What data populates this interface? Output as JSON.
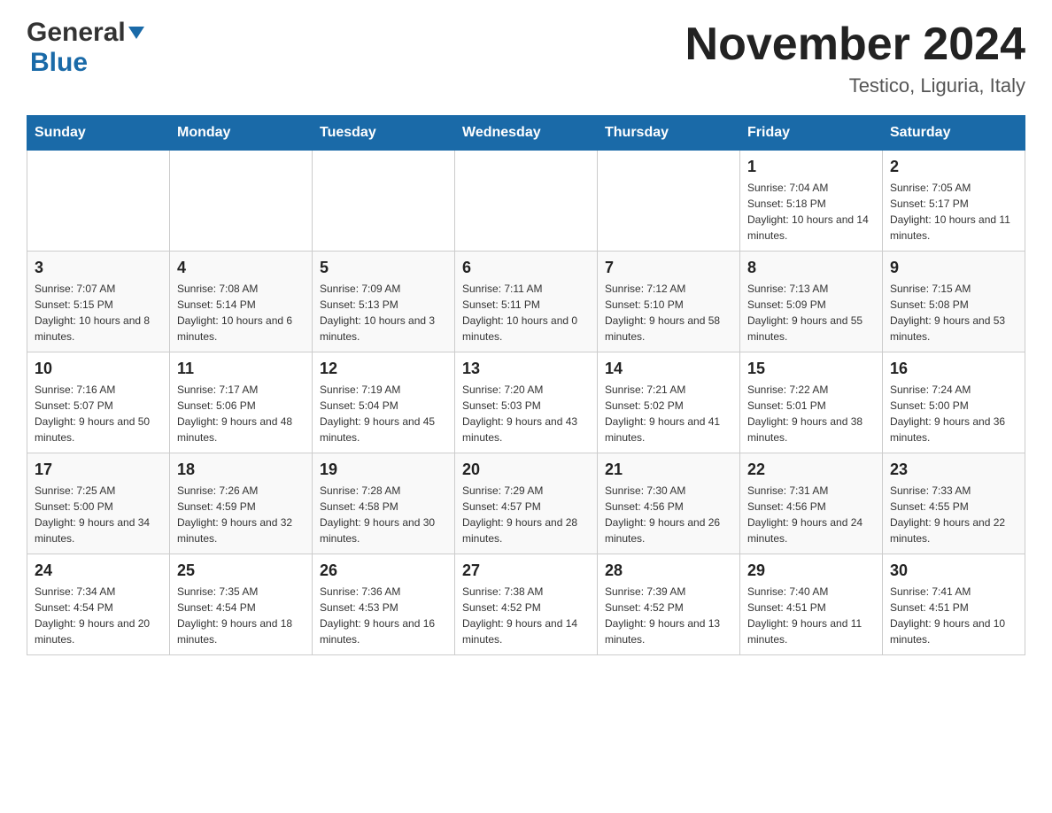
{
  "header": {
    "logo_general": "General",
    "logo_blue": "Blue",
    "month_year": "November 2024",
    "location": "Testico, Liguria, Italy"
  },
  "weekdays": [
    "Sunday",
    "Monday",
    "Tuesday",
    "Wednesday",
    "Thursday",
    "Friday",
    "Saturday"
  ],
  "weeks": [
    [
      {
        "day": "",
        "sunrise": "",
        "sunset": "",
        "daylight": ""
      },
      {
        "day": "",
        "sunrise": "",
        "sunset": "",
        "daylight": ""
      },
      {
        "day": "",
        "sunrise": "",
        "sunset": "",
        "daylight": ""
      },
      {
        "day": "",
        "sunrise": "",
        "sunset": "",
        "daylight": ""
      },
      {
        "day": "",
        "sunrise": "",
        "sunset": "",
        "daylight": ""
      },
      {
        "day": "1",
        "sunrise": "Sunrise: 7:04 AM",
        "sunset": "Sunset: 5:18 PM",
        "daylight": "Daylight: 10 hours and 14 minutes."
      },
      {
        "day": "2",
        "sunrise": "Sunrise: 7:05 AM",
        "sunset": "Sunset: 5:17 PM",
        "daylight": "Daylight: 10 hours and 11 minutes."
      }
    ],
    [
      {
        "day": "3",
        "sunrise": "Sunrise: 7:07 AM",
        "sunset": "Sunset: 5:15 PM",
        "daylight": "Daylight: 10 hours and 8 minutes."
      },
      {
        "day": "4",
        "sunrise": "Sunrise: 7:08 AM",
        "sunset": "Sunset: 5:14 PM",
        "daylight": "Daylight: 10 hours and 6 minutes."
      },
      {
        "day": "5",
        "sunrise": "Sunrise: 7:09 AM",
        "sunset": "Sunset: 5:13 PM",
        "daylight": "Daylight: 10 hours and 3 minutes."
      },
      {
        "day": "6",
        "sunrise": "Sunrise: 7:11 AM",
        "sunset": "Sunset: 5:11 PM",
        "daylight": "Daylight: 10 hours and 0 minutes."
      },
      {
        "day": "7",
        "sunrise": "Sunrise: 7:12 AM",
        "sunset": "Sunset: 5:10 PM",
        "daylight": "Daylight: 9 hours and 58 minutes."
      },
      {
        "day": "8",
        "sunrise": "Sunrise: 7:13 AM",
        "sunset": "Sunset: 5:09 PM",
        "daylight": "Daylight: 9 hours and 55 minutes."
      },
      {
        "day": "9",
        "sunrise": "Sunrise: 7:15 AM",
        "sunset": "Sunset: 5:08 PM",
        "daylight": "Daylight: 9 hours and 53 minutes."
      }
    ],
    [
      {
        "day": "10",
        "sunrise": "Sunrise: 7:16 AM",
        "sunset": "Sunset: 5:07 PM",
        "daylight": "Daylight: 9 hours and 50 minutes."
      },
      {
        "day": "11",
        "sunrise": "Sunrise: 7:17 AM",
        "sunset": "Sunset: 5:06 PM",
        "daylight": "Daylight: 9 hours and 48 minutes."
      },
      {
        "day": "12",
        "sunrise": "Sunrise: 7:19 AM",
        "sunset": "Sunset: 5:04 PM",
        "daylight": "Daylight: 9 hours and 45 minutes."
      },
      {
        "day": "13",
        "sunrise": "Sunrise: 7:20 AM",
        "sunset": "Sunset: 5:03 PM",
        "daylight": "Daylight: 9 hours and 43 minutes."
      },
      {
        "day": "14",
        "sunrise": "Sunrise: 7:21 AM",
        "sunset": "Sunset: 5:02 PM",
        "daylight": "Daylight: 9 hours and 41 minutes."
      },
      {
        "day": "15",
        "sunrise": "Sunrise: 7:22 AM",
        "sunset": "Sunset: 5:01 PM",
        "daylight": "Daylight: 9 hours and 38 minutes."
      },
      {
        "day": "16",
        "sunrise": "Sunrise: 7:24 AM",
        "sunset": "Sunset: 5:00 PM",
        "daylight": "Daylight: 9 hours and 36 minutes."
      }
    ],
    [
      {
        "day": "17",
        "sunrise": "Sunrise: 7:25 AM",
        "sunset": "Sunset: 5:00 PM",
        "daylight": "Daylight: 9 hours and 34 minutes."
      },
      {
        "day": "18",
        "sunrise": "Sunrise: 7:26 AM",
        "sunset": "Sunset: 4:59 PM",
        "daylight": "Daylight: 9 hours and 32 minutes."
      },
      {
        "day": "19",
        "sunrise": "Sunrise: 7:28 AM",
        "sunset": "Sunset: 4:58 PM",
        "daylight": "Daylight: 9 hours and 30 minutes."
      },
      {
        "day": "20",
        "sunrise": "Sunrise: 7:29 AM",
        "sunset": "Sunset: 4:57 PM",
        "daylight": "Daylight: 9 hours and 28 minutes."
      },
      {
        "day": "21",
        "sunrise": "Sunrise: 7:30 AM",
        "sunset": "Sunset: 4:56 PM",
        "daylight": "Daylight: 9 hours and 26 minutes."
      },
      {
        "day": "22",
        "sunrise": "Sunrise: 7:31 AM",
        "sunset": "Sunset: 4:56 PM",
        "daylight": "Daylight: 9 hours and 24 minutes."
      },
      {
        "day": "23",
        "sunrise": "Sunrise: 7:33 AM",
        "sunset": "Sunset: 4:55 PM",
        "daylight": "Daylight: 9 hours and 22 minutes."
      }
    ],
    [
      {
        "day": "24",
        "sunrise": "Sunrise: 7:34 AM",
        "sunset": "Sunset: 4:54 PM",
        "daylight": "Daylight: 9 hours and 20 minutes."
      },
      {
        "day": "25",
        "sunrise": "Sunrise: 7:35 AM",
        "sunset": "Sunset: 4:54 PM",
        "daylight": "Daylight: 9 hours and 18 minutes."
      },
      {
        "day": "26",
        "sunrise": "Sunrise: 7:36 AM",
        "sunset": "Sunset: 4:53 PM",
        "daylight": "Daylight: 9 hours and 16 minutes."
      },
      {
        "day": "27",
        "sunrise": "Sunrise: 7:38 AM",
        "sunset": "Sunset: 4:52 PM",
        "daylight": "Daylight: 9 hours and 14 minutes."
      },
      {
        "day": "28",
        "sunrise": "Sunrise: 7:39 AM",
        "sunset": "Sunset: 4:52 PM",
        "daylight": "Daylight: 9 hours and 13 minutes."
      },
      {
        "day": "29",
        "sunrise": "Sunrise: 7:40 AM",
        "sunset": "Sunset: 4:51 PM",
        "daylight": "Daylight: 9 hours and 11 minutes."
      },
      {
        "day": "30",
        "sunrise": "Sunrise: 7:41 AM",
        "sunset": "Sunset: 4:51 PM",
        "daylight": "Daylight: 9 hours and 10 minutes."
      }
    ]
  ]
}
